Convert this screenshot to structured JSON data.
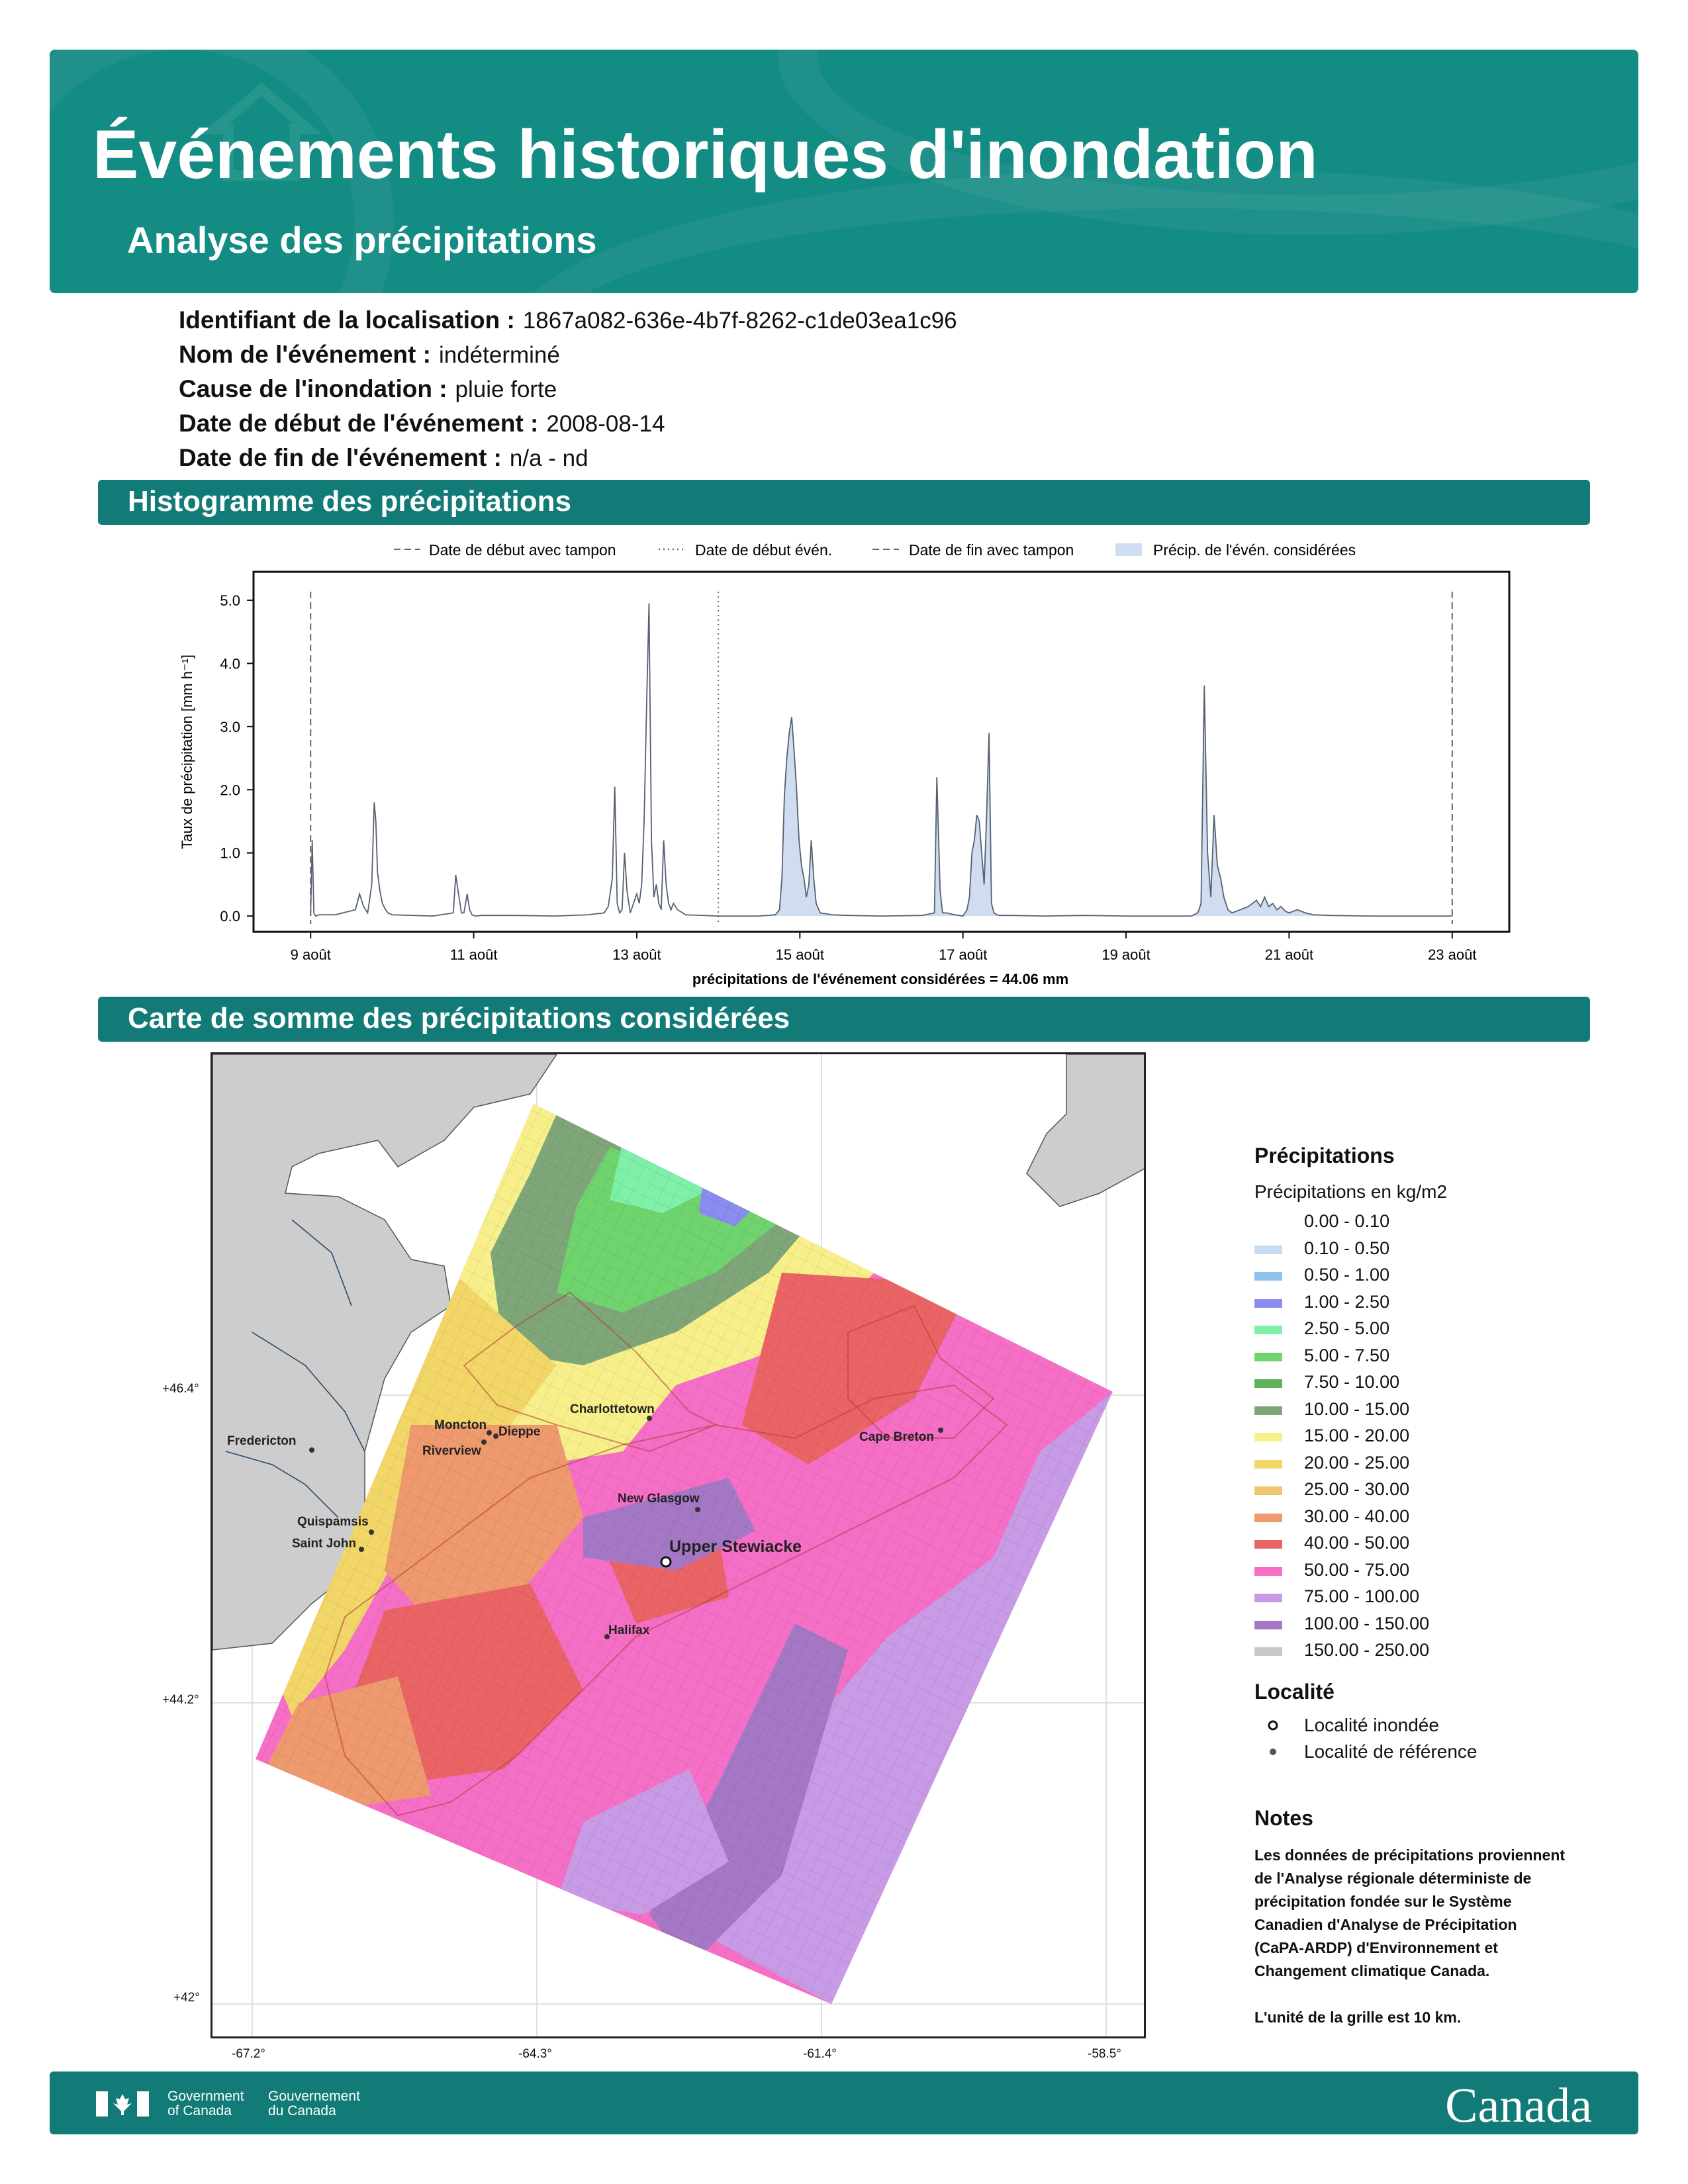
{
  "header": {
    "title": "Événements historiques d'inondation",
    "subtitle": "Analyse des précipitations"
  },
  "info": [
    {
      "label": "Identifiant de la localisation :",
      "value": "1867a082-636e-4b7f-8262-c1de03ea1c96"
    },
    {
      "label": "Nom de l'événement :",
      "value": "indéterminé"
    },
    {
      "label": "Cause de l'inondation :",
      "value": "pluie forte"
    },
    {
      "label": "Date de début de l'événement :",
      "value": "2008-08-14"
    },
    {
      "label": "Date de fin de l'événement :",
      "value": "n/a - nd"
    }
  ],
  "sections": {
    "histogram": "Histogramme des précipitations",
    "map": "Carte de somme des précipitations considérées"
  },
  "chart_data": {
    "type": "area",
    "ylabel": "Taux de précipitation [mm h⁻¹]",
    "xlabel": "précipitations de l'événement considérées = 44.06 mm",
    "xticks": [
      "9 août",
      "11 août",
      "13 août",
      "15 août",
      "17 août",
      "19 août",
      "21 août",
      "23 août"
    ],
    "xtick_days": [
      9,
      11,
      13,
      15,
      17,
      19,
      21,
      23
    ],
    "yticks": [
      "0.0",
      "1.0",
      "2.0",
      "3.0",
      "4.0",
      "5.0"
    ],
    "xlim": [
      8.3,
      23.7
    ],
    "ylim": [
      -0.25,
      5.45
    ],
    "legend": [
      {
        "name": "Date de début avec tampon",
        "style": "dashed"
      },
      {
        "name": "Date de début évén.",
        "style": "dotted"
      },
      {
        "name": "Date de fin avec tampon",
        "style": "dashed"
      },
      {
        "name": "Précip. de l'évén. considérées",
        "style": "fill"
      }
    ],
    "vlines": [
      {
        "day": 9.0,
        "style": "dashed"
      },
      {
        "day": 14.0,
        "style": "dotted"
      },
      {
        "day": 23.0,
        "style": "dashed"
      }
    ],
    "shaded_start_day": 14.0,
    "series": [
      {
        "x": [
          9.0,
          9.02,
          9.04,
          9.06,
          9.1,
          9.3,
          9.55,
          9.6,
          9.65,
          9.7,
          9.75,
          9.78,
          9.8,
          9.82,
          9.85,
          9.88,
          9.92,
          9.95,
          10.0,
          10.5,
          10.75,
          10.78,
          10.82,
          10.85,
          10.88,
          10.92,
          10.95,
          10.98,
          11.02,
          11.1,
          11.5,
          12.0,
          12.4,
          12.6,
          12.65,
          12.7,
          12.73,
          12.76,
          12.79,
          12.82,
          12.85,
          12.88,
          12.92,
          12.96,
          13.0,
          13.03,
          13.06,
          13.09,
          13.12,
          13.15,
          13.18,
          13.21,
          13.24,
          13.27,
          13.3,
          13.33,
          13.36,
          13.39,
          13.42,
          13.45,
          13.5,
          13.6,
          14.0,
          14.5,
          14.7,
          14.75,
          14.78,
          14.81,
          14.84,
          14.87,
          14.9,
          14.93,
          14.96,
          14.99,
          15.02,
          15.05,
          15.08,
          15.11,
          15.14,
          15.17,
          15.2,
          15.25,
          15.4,
          15.6,
          16.0,
          16.5,
          16.65,
          16.68,
          16.72,
          16.75,
          16.8,
          16.9,
          17.0,
          17.05,
          17.08,
          17.11,
          17.14,
          17.17,
          17.2,
          17.23,
          17.26,
          17.29,
          17.32,
          17.35,
          17.38,
          17.42,
          17.45,
          17.5,
          17.6,
          18.0,
          18.5,
          19.0,
          19.5,
          19.8,
          19.88,
          19.92,
          19.96,
          20.0,
          20.04,
          20.08,
          20.12,
          20.16,
          20.2,
          20.25,
          20.3,
          20.4,
          20.5,
          20.55,
          20.6,
          20.65,
          20.7,
          20.75,
          20.8,
          20.85,
          20.9,
          20.95,
          21.0,
          21.1,
          21.2,
          21.3,
          21.5,
          22.0,
          22.5,
          23.0
        ],
        "y": [
          0.0,
          1.2,
          0.05,
          0.0,
          0.02,
          0.02,
          0.1,
          0.35,
          0.15,
          0.05,
          0.5,
          1.8,
          1.5,
          0.7,
          0.4,
          0.2,
          0.1,
          0.05,
          0.02,
          0.0,
          0.05,
          0.65,
          0.3,
          0.05,
          0.05,
          0.35,
          0.1,
          0.02,
          0.0,
          0.01,
          0.01,
          0.0,
          0.02,
          0.05,
          0.15,
          0.6,
          2.05,
          0.2,
          0.05,
          0.1,
          1.0,
          0.4,
          0.05,
          0.2,
          0.35,
          0.2,
          0.5,
          1.5,
          3.3,
          4.95,
          1.2,
          0.3,
          0.5,
          0.2,
          0.1,
          1.2,
          0.5,
          0.2,
          0.1,
          0.2,
          0.1,
          0.02,
          0.0,
          0.0,
          0.02,
          0.1,
          0.6,
          1.9,
          2.5,
          2.9,
          3.15,
          2.6,
          2.0,
          1.2,
          0.8,
          0.6,
          0.3,
          0.5,
          1.2,
          0.6,
          0.2,
          0.05,
          0.02,
          0.01,
          0.0,
          0.01,
          0.05,
          2.2,
          0.4,
          0.05,
          0.05,
          0.02,
          0.0,
          0.1,
          0.3,
          1.0,
          1.2,
          1.6,
          1.5,
          1.0,
          0.5,
          1.6,
          2.9,
          0.2,
          0.05,
          0.02,
          0.01,
          0.01,
          0.01,
          0.0,
          0.01,
          0.0,
          0.0,
          0.0,
          0.05,
          0.2,
          3.65,
          1.0,
          0.3,
          1.6,
          0.8,
          0.6,
          0.3,
          0.1,
          0.05,
          0.1,
          0.15,
          0.2,
          0.25,
          0.15,
          0.3,
          0.15,
          0.2,
          0.1,
          0.15,
          0.08,
          0.05,
          0.1,
          0.05,
          0.02,
          0.01,
          0.0,
          0.0,
          0.0
        ]
      }
    ]
  },
  "map": {
    "lon_ticks": [
      "-67.2°",
      "-64.3°",
      "-61.4°",
      "-58.5°"
    ],
    "lat_ticks": [
      "+46.4°",
      "+44.2°",
      "+42°"
    ],
    "cities": [
      {
        "name": "Fredericton",
        "flooded": false
      },
      {
        "name": "Moncton",
        "flooded": false
      },
      {
        "name": "Dieppe",
        "flooded": false
      },
      {
        "name": "Riverview",
        "flooded": false
      },
      {
        "name": "Charlottetown",
        "flooded": false
      },
      {
        "name": "Cape Breton",
        "flooded": false
      },
      {
        "name": "New Glasgow",
        "flooded": false
      },
      {
        "name": "Quispamsis",
        "flooded": false
      },
      {
        "name": "Saint John",
        "flooded": false
      },
      {
        "name": "Upper Stewiacke",
        "flooded": true
      },
      {
        "name": "Halifax",
        "flooded": false
      }
    ]
  },
  "legend": {
    "precip_title": "Précipitations",
    "precip_subtitle": "Précipitations en kg/m2",
    "bins": [
      {
        "range": "0.00 - 0.10",
        "color": "#ffffff"
      },
      {
        "range": "0.10 - 0.50",
        "color": "#c6dcf2"
      },
      {
        "range": "0.50 - 1.00",
        "color": "#8ec3ee"
      },
      {
        "range": "1.00 - 2.50",
        "color": "#8a8cf0"
      },
      {
        "range": "2.50 - 5.00",
        "color": "#7ef0a8"
      },
      {
        "range": "5.00 - 7.50",
        "color": "#6fd46e"
      },
      {
        "range": "7.50 - 10.00",
        "color": "#5fb25b"
      },
      {
        "range": "10.00 - 15.00",
        "color": "#7fa678"
      },
      {
        "range": "15.00 - 20.00",
        "color": "#f7f08a"
      },
      {
        "range": "20.00 - 25.00",
        "color": "#f2d768"
      },
      {
        "range": "25.00 - 30.00",
        "color": "#efc56e"
      },
      {
        "range": "30.00 - 40.00",
        "color": "#ee9a6e"
      },
      {
        "range": "40.00 - 50.00",
        "color": "#ea6466"
      },
      {
        "range": "50.00 - 75.00",
        "color": "#f56fc6"
      },
      {
        "range": "75.00 - 100.00",
        "color": "#c89be6"
      },
      {
        "range": "100.00 - 150.00",
        "color": "#a578c6"
      },
      {
        "range": "150.00 - 250.00",
        "color": "#c8c8c8"
      }
    ],
    "locality_title": "Localité",
    "locality_items": [
      "Localité inondée",
      "Localité de référence"
    ],
    "notes_title": "Notes",
    "notes_body": "Les données de précipitations proviennent\nde l'Analyse régionale déterministe de\nprécipitation fondée sur le Système\nCanadien d'Analyse de Précipitation\n(CaPA-ARDP) d'Environnement et\nChangement climatique Canada.\n\nL'unité de la grille est 10 km."
  },
  "footer": {
    "gov_en_1": "Government",
    "gov_en_2": "of Canada",
    "gov_fr_1": "Gouvernement",
    "gov_fr_2": "du Canada",
    "wordmark": "Canada"
  }
}
